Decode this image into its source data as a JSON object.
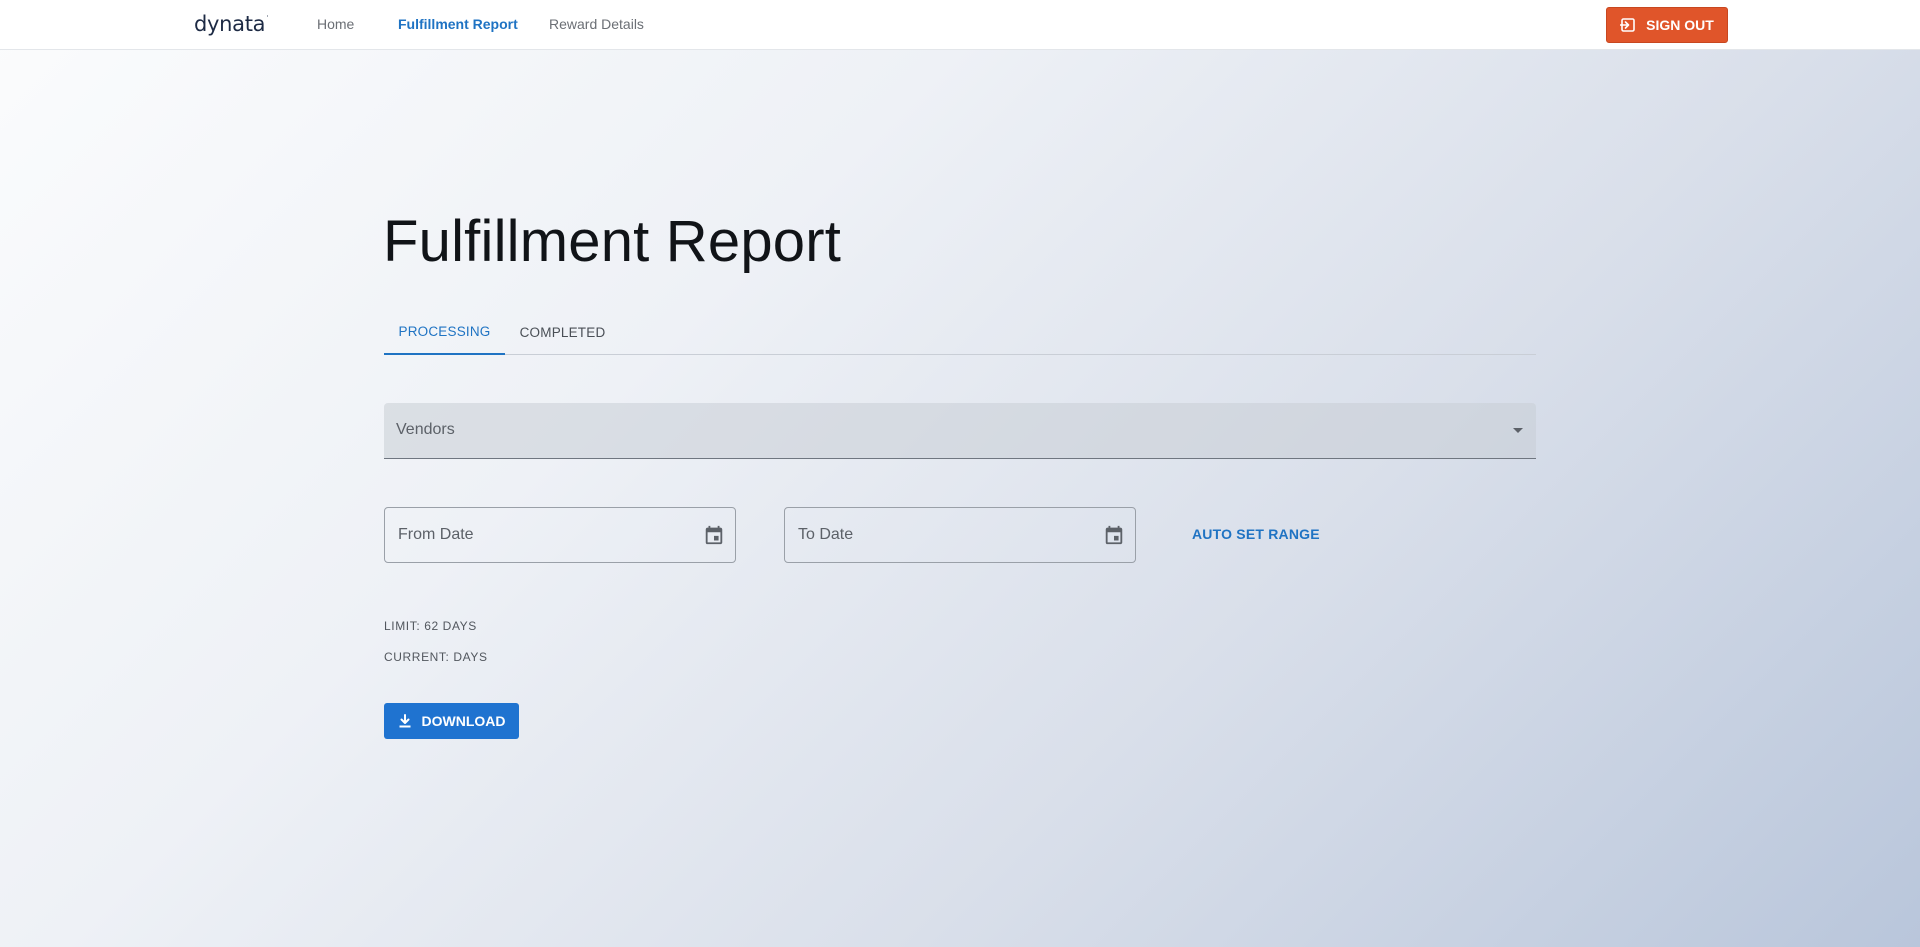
{
  "header": {
    "logo_text": "dynata",
    "logo_mark": "·",
    "nav": [
      {
        "label": "Home",
        "active": false
      },
      {
        "label": "Fulfillment Report",
        "active": true
      },
      {
        "label": "Reward Details",
        "active": false
      }
    ],
    "signout_label": "SIGN OUT",
    "signout_icon": "sign-out-icon",
    "signout_color": "#e0552a"
  },
  "main": {
    "title": "Fulfillment Report",
    "tabs": [
      {
        "label": "PROCESSING",
        "active": true
      },
      {
        "label": "COMPLETED",
        "active": false
      }
    ],
    "vendors_label": "Vendors",
    "from_date_placeholder": "From Date",
    "to_date_placeholder": "To Date",
    "calendar_icon": "calendar-icon",
    "auto_set_range_label": "AUTO SET RANGE",
    "limit_text": "LIMIT: 62 DAYS",
    "current_text": "CURRENT: DAYS",
    "download_label": "DOWNLOAD",
    "download_icon": "download-icon"
  },
  "colors": {
    "accent": "#1f73c3",
    "download_button": "#1f73d0"
  }
}
